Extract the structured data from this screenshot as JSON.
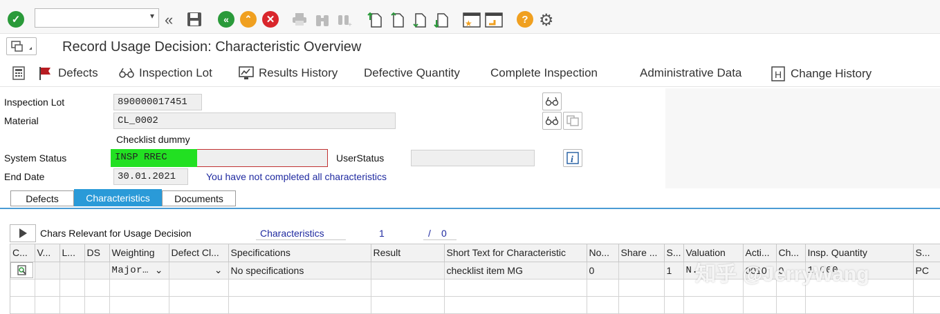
{
  "toolbar": {
    "command_field_value": "",
    "icons": [
      "enter-check-icon",
      "back-icon",
      "save-icon",
      "back-green-icon",
      "exit-up-icon",
      "cancel-icon",
      "print-icon",
      "find-icon",
      "find-next-icon",
      "first-page-icon",
      "previous-page-icon",
      "next-page-icon",
      "last-page-icon",
      "new-session-icon",
      "shortcut-icon",
      "help-icon",
      "settings-gear-icon"
    ],
    "colors": {
      "green": "#2a9a3a",
      "orange": "#f0a020",
      "red": "#d9262c",
      "help": "#f0a020"
    }
  },
  "title": "Record Usage Decision: Characteristic Overview",
  "app_toolbar": [
    {
      "label": "Defects",
      "icon": "flag-icon"
    },
    {
      "label": "Inspection Lot",
      "icon": "glasses-icon"
    },
    {
      "label": "Results History",
      "icon": "monitor-chart-icon"
    },
    {
      "label": "Defective Quantity"
    },
    {
      "label": "Complete Inspection"
    },
    {
      "label": "Administrative Data"
    },
    {
      "label": "Change History",
      "icon": "history-h-icon"
    }
  ],
  "header": {
    "inspection_lot_label": "Inspection Lot",
    "inspection_lot_value": "890000017451",
    "material_label": "Material",
    "material_value": "CL_0002",
    "material_description": "Checklist dummy",
    "system_status_label": "System Status",
    "system_status_value": "INSP RREC",
    "user_status_label": "UserStatus",
    "user_status_value": "",
    "end_date_label": "End Date",
    "end_date_value": "30.01.2021",
    "message": "You have not completed all characteristics",
    "highlight_color": "#22e022",
    "message_color": "#1f2aa0"
  },
  "tabs": [
    {
      "label": "Defects",
      "active": false
    },
    {
      "label": "Characteristics",
      "active": true
    },
    {
      "label": "Documents",
      "active": false
    }
  ],
  "list_info": {
    "title": "Chars Relevant for Usage Decision",
    "filter_label": "Characteristics",
    "count": "1",
    "slash": "/",
    "total": "0"
  },
  "grid": {
    "columns": [
      "C...",
      "V...",
      "L...",
      "DS",
      "Weighting",
      "Defect Cl...",
      "Specifications",
      "Result",
      "Short Text for Characteristic",
      "No...",
      "Share ...",
      "S...",
      "Valuation",
      "Acti...",
      "Ch...",
      "Insp. Quantity",
      "S..."
    ],
    "rows": [
      {
        "weighting": "Major…",
        "defect_class": "",
        "specifications": "No specifications",
        "result": "",
        "short_text": "checklist item MG",
        "no": "0",
        "share": "",
        "s": "1",
        "valuation": "N...",
        "acti": "0010",
        "ch": "0",
        "insp_quantity": "1,000",
        "unit": "PC"
      }
    ]
  },
  "watermark": "知乎 @JerryWang"
}
